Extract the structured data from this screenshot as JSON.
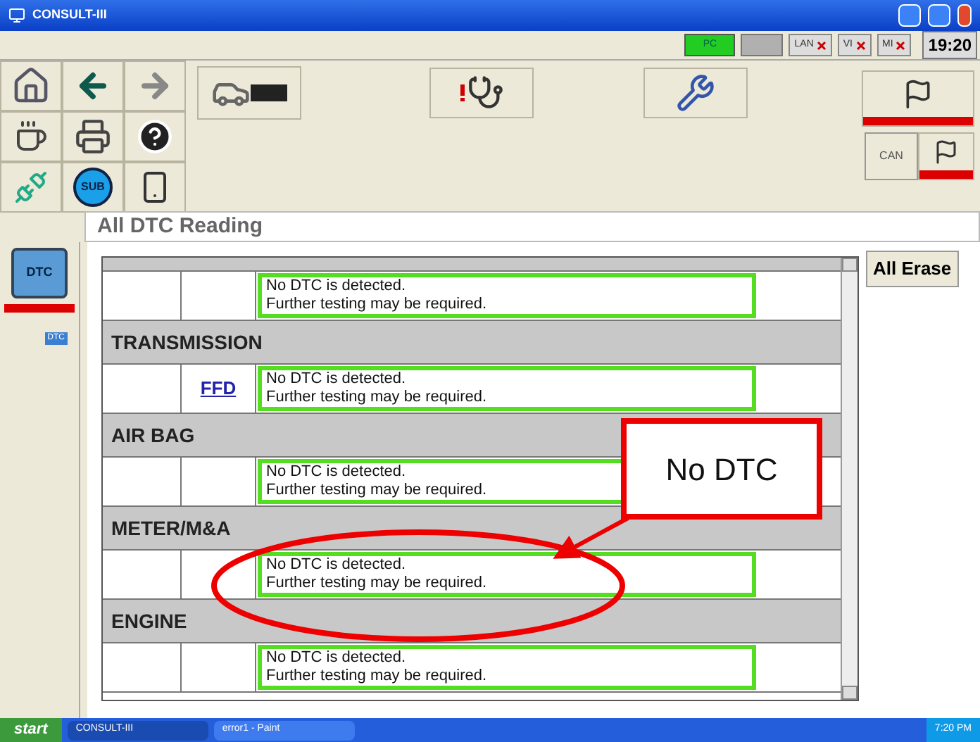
{
  "window": {
    "title": "CONSULT-III"
  },
  "status_indicators": [
    {
      "kind": "battery",
      "label": "PC"
    },
    {
      "kind": "blank"
    },
    {
      "kind": "lan",
      "label": "LAN"
    },
    {
      "kind": "vi",
      "label": "VI"
    },
    {
      "kind": "mi",
      "label": "MI"
    }
  ],
  "clock": "19:20",
  "toolbar": {
    "sub_label": "SUB",
    "can_label": "CAN"
  },
  "sidebar": {
    "dtc_label": "DTC",
    "dtc_small_label": "DTC"
  },
  "page_title": "All DTC Reading",
  "table_rows": [
    {
      "kind": "section"
    },
    {
      "kind": "result",
      "message_lines": [
        "No DTC is detected.",
        "Further testing may be required."
      ]
    },
    {
      "kind": "section",
      "label": "TRANSMISSION"
    },
    {
      "kind": "result",
      "link": "FFD",
      "message_lines": [
        "No DTC is detected.",
        "Further testing may be required."
      ]
    },
    {
      "kind": "section",
      "label": "AIR BAG"
    },
    {
      "kind": "result",
      "message_lines": [
        "No DTC is detected.",
        "Further testing may be required."
      ]
    },
    {
      "kind": "section",
      "label": "METER/M&A"
    },
    {
      "kind": "result",
      "message_lines": [
        "No DTC is detected.",
        "Further testing may be required."
      ]
    },
    {
      "kind": "section",
      "label": "ENGINE"
    },
    {
      "kind": "result",
      "message_lines": [
        "No DTC is detected.",
        "Further testing may be required."
      ]
    }
  ],
  "erase_button": "All Erase",
  "annotation": {
    "callout": "No DTC"
  },
  "taskbar": {
    "start": "start",
    "tasks": [
      {
        "label": "CONSULT-III",
        "selected": true
      },
      {
        "label": "error1 - Paint",
        "selected": false
      }
    ],
    "clock": "7:20 PM"
  }
}
